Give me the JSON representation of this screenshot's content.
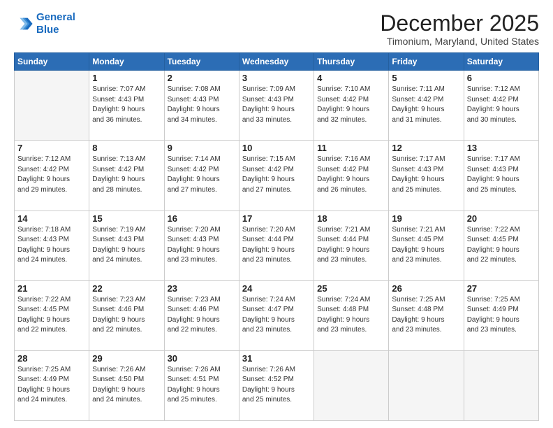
{
  "header": {
    "logo_line1": "General",
    "logo_line2": "Blue",
    "main_title": "December 2025",
    "subtitle": "Timonium, Maryland, United States"
  },
  "days_of_week": [
    "Sunday",
    "Monday",
    "Tuesday",
    "Wednesday",
    "Thursday",
    "Friday",
    "Saturday"
  ],
  "weeks": [
    [
      {
        "day": "",
        "info": ""
      },
      {
        "day": "1",
        "info": "Sunrise: 7:07 AM\nSunset: 4:43 PM\nDaylight: 9 hours\nand 36 minutes."
      },
      {
        "day": "2",
        "info": "Sunrise: 7:08 AM\nSunset: 4:43 PM\nDaylight: 9 hours\nand 34 minutes."
      },
      {
        "day": "3",
        "info": "Sunrise: 7:09 AM\nSunset: 4:43 PM\nDaylight: 9 hours\nand 33 minutes."
      },
      {
        "day": "4",
        "info": "Sunrise: 7:10 AM\nSunset: 4:42 PM\nDaylight: 9 hours\nand 32 minutes."
      },
      {
        "day": "5",
        "info": "Sunrise: 7:11 AM\nSunset: 4:42 PM\nDaylight: 9 hours\nand 31 minutes."
      },
      {
        "day": "6",
        "info": "Sunrise: 7:12 AM\nSunset: 4:42 PM\nDaylight: 9 hours\nand 30 minutes."
      }
    ],
    [
      {
        "day": "7",
        "info": "Sunrise: 7:12 AM\nSunset: 4:42 PM\nDaylight: 9 hours\nand 29 minutes."
      },
      {
        "day": "8",
        "info": "Sunrise: 7:13 AM\nSunset: 4:42 PM\nDaylight: 9 hours\nand 28 minutes."
      },
      {
        "day": "9",
        "info": "Sunrise: 7:14 AM\nSunset: 4:42 PM\nDaylight: 9 hours\nand 27 minutes."
      },
      {
        "day": "10",
        "info": "Sunrise: 7:15 AM\nSunset: 4:42 PM\nDaylight: 9 hours\nand 27 minutes."
      },
      {
        "day": "11",
        "info": "Sunrise: 7:16 AM\nSunset: 4:42 PM\nDaylight: 9 hours\nand 26 minutes."
      },
      {
        "day": "12",
        "info": "Sunrise: 7:17 AM\nSunset: 4:43 PM\nDaylight: 9 hours\nand 25 minutes."
      },
      {
        "day": "13",
        "info": "Sunrise: 7:17 AM\nSunset: 4:43 PM\nDaylight: 9 hours\nand 25 minutes."
      }
    ],
    [
      {
        "day": "14",
        "info": "Sunrise: 7:18 AM\nSunset: 4:43 PM\nDaylight: 9 hours\nand 24 minutes."
      },
      {
        "day": "15",
        "info": "Sunrise: 7:19 AM\nSunset: 4:43 PM\nDaylight: 9 hours\nand 24 minutes."
      },
      {
        "day": "16",
        "info": "Sunrise: 7:20 AM\nSunset: 4:43 PM\nDaylight: 9 hours\nand 23 minutes."
      },
      {
        "day": "17",
        "info": "Sunrise: 7:20 AM\nSunset: 4:44 PM\nDaylight: 9 hours\nand 23 minutes."
      },
      {
        "day": "18",
        "info": "Sunrise: 7:21 AM\nSunset: 4:44 PM\nDaylight: 9 hours\nand 23 minutes."
      },
      {
        "day": "19",
        "info": "Sunrise: 7:21 AM\nSunset: 4:45 PM\nDaylight: 9 hours\nand 23 minutes."
      },
      {
        "day": "20",
        "info": "Sunrise: 7:22 AM\nSunset: 4:45 PM\nDaylight: 9 hours\nand 22 minutes."
      }
    ],
    [
      {
        "day": "21",
        "info": "Sunrise: 7:22 AM\nSunset: 4:45 PM\nDaylight: 9 hours\nand 22 minutes."
      },
      {
        "day": "22",
        "info": "Sunrise: 7:23 AM\nSunset: 4:46 PM\nDaylight: 9 hours\nand 22 minutes."
      },
      {
        "day": "23",
        "info": "Sunrise: 7:23 AM\nSunset: 4:46 PM\nDaylight: 9 hours\nand 22 minutes."
      },
      {
        "day": "24",
        "info": "Sunrise: 7:24 AM\nSunset: 4:47 PM\nDaylight: 9 hours\nand 23 minutes."
      },
      {
        "day": "25",
        "info": "Sunrise: 7:24 AM\nSunset: 4:48 PM\nDaylight: 9 hours\nand 23 minutes."
      },
      {
        "day": "26",
        "info": "Sunrise: 7:25 AM\nSunset: 4:48 PM\nDaylight: 9 hours\nand 23 minutes."
      },
      {
        "day": "27",
        "info": "Sunrise: 7:25 AM\nSunset: 4:49 PM\nDaylight: 9 hours\nand 23 minutes."
      }
    ],
    [
      {
        "day": "28",
        "info": "Sunrise: 7:25 AM\nSunset: 4:49 PM\nDaylight: 9 hours\nand 24 minutes."
      },
      {
        "day": "29",
        "info": "Sunrise: 7:26 AM\nSunset: 4:50 PM\nDaylight: 9 hours\nand 24 minutes."
      },
      {
        "day": "30",
        "info": "Sunrise: 7:26 AM\nSunset: 4:51 PM\nDaylight: 9 hours\nand 25 minutes."
      },
      {
        "day": "31",
        "info": "Sunrise: 7:26 AM\nSunset: 4:52 PM\nDaylight: 9 hours\nand 25 minutes."
      },
      {
        "day": "",
        "info": ""
      },
      {
        "day": "",
        "info": ""
      },
      {
        "day": "",
        "info": ""
      }
    ]
  ]
}
